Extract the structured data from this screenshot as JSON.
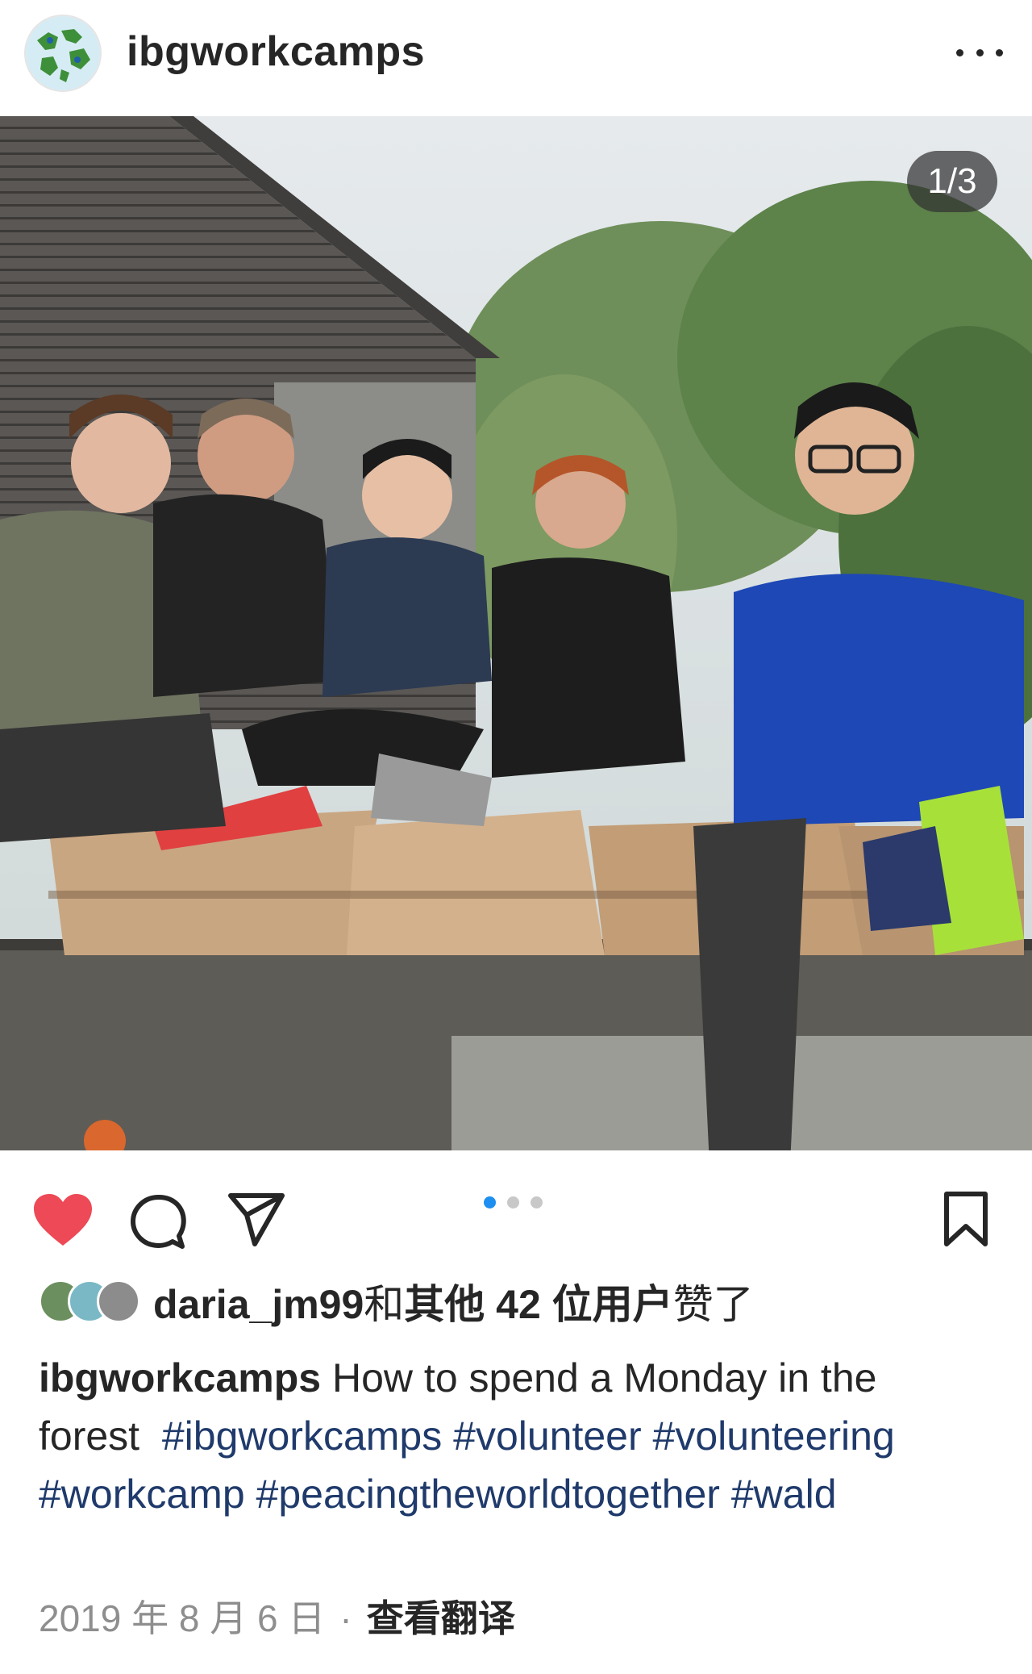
{
  "post": {
    "username": "ibgworkcamps",
    "image_counter": "1/3",
    "liked_by_user": "daria_jm99",
    "likes_text_1": "和",
    "likes_text_2": "其他 42 位用户",
    "likes_text_3": "赞了",
    "caption_user": "ibgworkcamps",
    "caption_text": "How to spend a Monday in the forest",
    "hashtags": [
      "#ibgworkcamps",
      "#volunteer",
      "#volunteering",
      "#workcamp",
      "#peacingtheworldtogether",
      "#wald"
    ],
    "date": "2019 年 8 月 6 日",
    "separator": "·",
    "translate_label": "查看翻译"
  },
  "icons": {
    "more": "more-icon",
    "like": "heart-icon",
    "comment": "comment-icon",
    "share": "share-icon",
    "save": "bookmark-icon"
  },
  "carousel": {
    "pages": 3,
    "active": 1
  },
  "colors": {
    "heart": "#ed4956",
    "carousel_active": "#1d8ff0",
    "hashtag": "#1f3a6b",
    "date": "#8e8e8e"
  }
}
